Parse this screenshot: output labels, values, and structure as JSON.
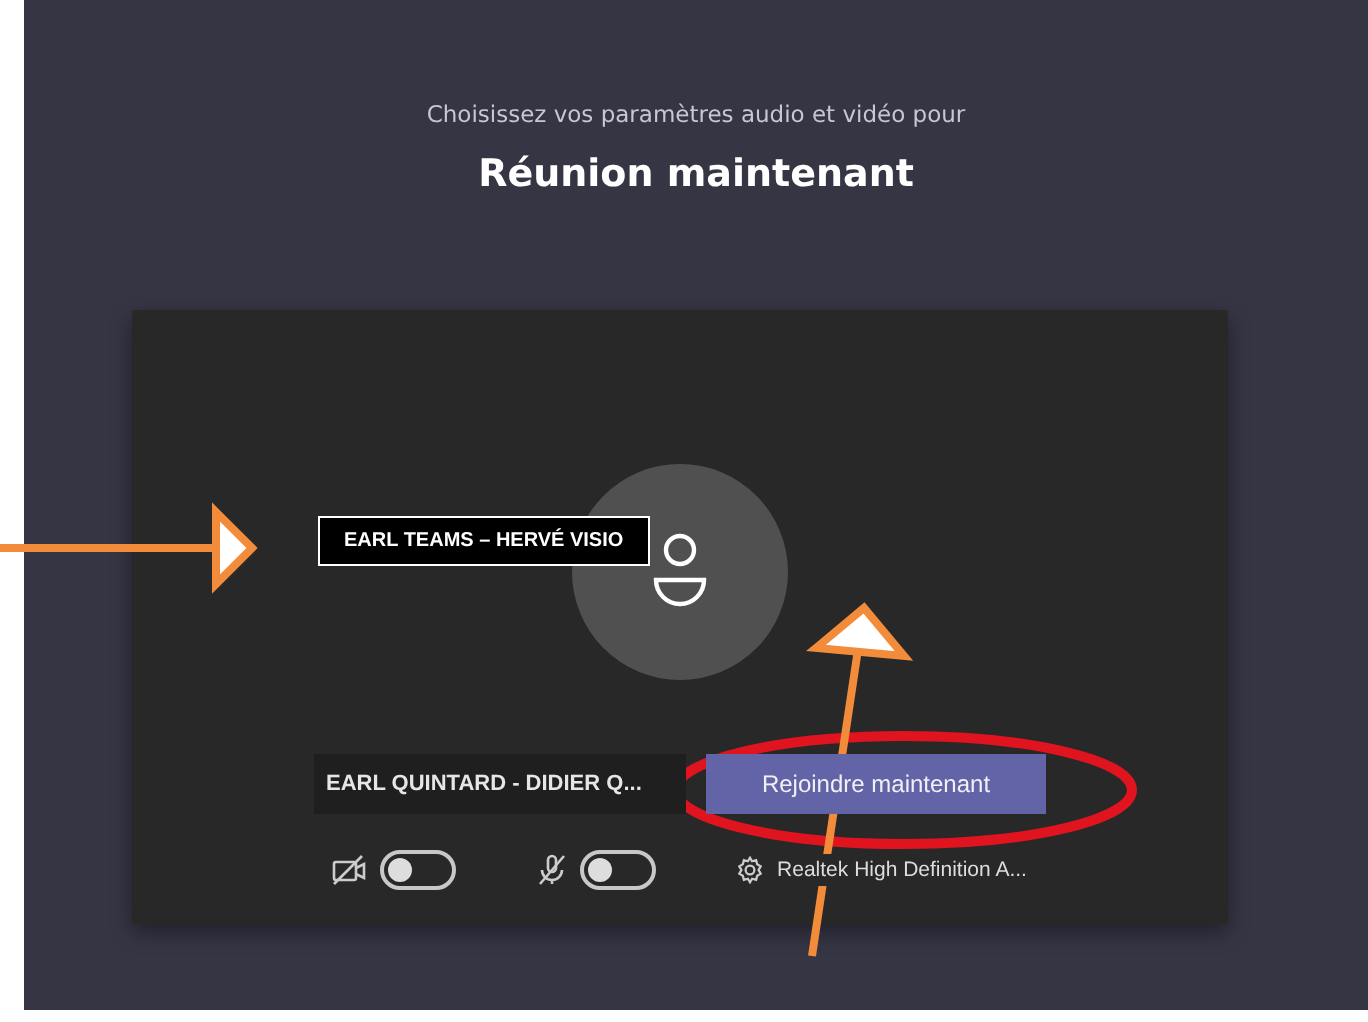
{
  "subtitle": "Choisissez vos paramètres audio et vidéo pour",
  "title": "Réunion maintenant",
  "name_field": {
    "value": "EARL QUINTARD - DIDIER Q..."
  },
  "join_button": "Rejoindre maintenant",
  "toggles": [
    {
      "kind": "camera",
      "on": false
    },
    {
      "kind": "mic",
      "on": false
    }
  ],
  "audio_device": "Realtek High Definition A...",
  "annotation_label": "EARL TEAMS – HERVÉ VISIO"
}
